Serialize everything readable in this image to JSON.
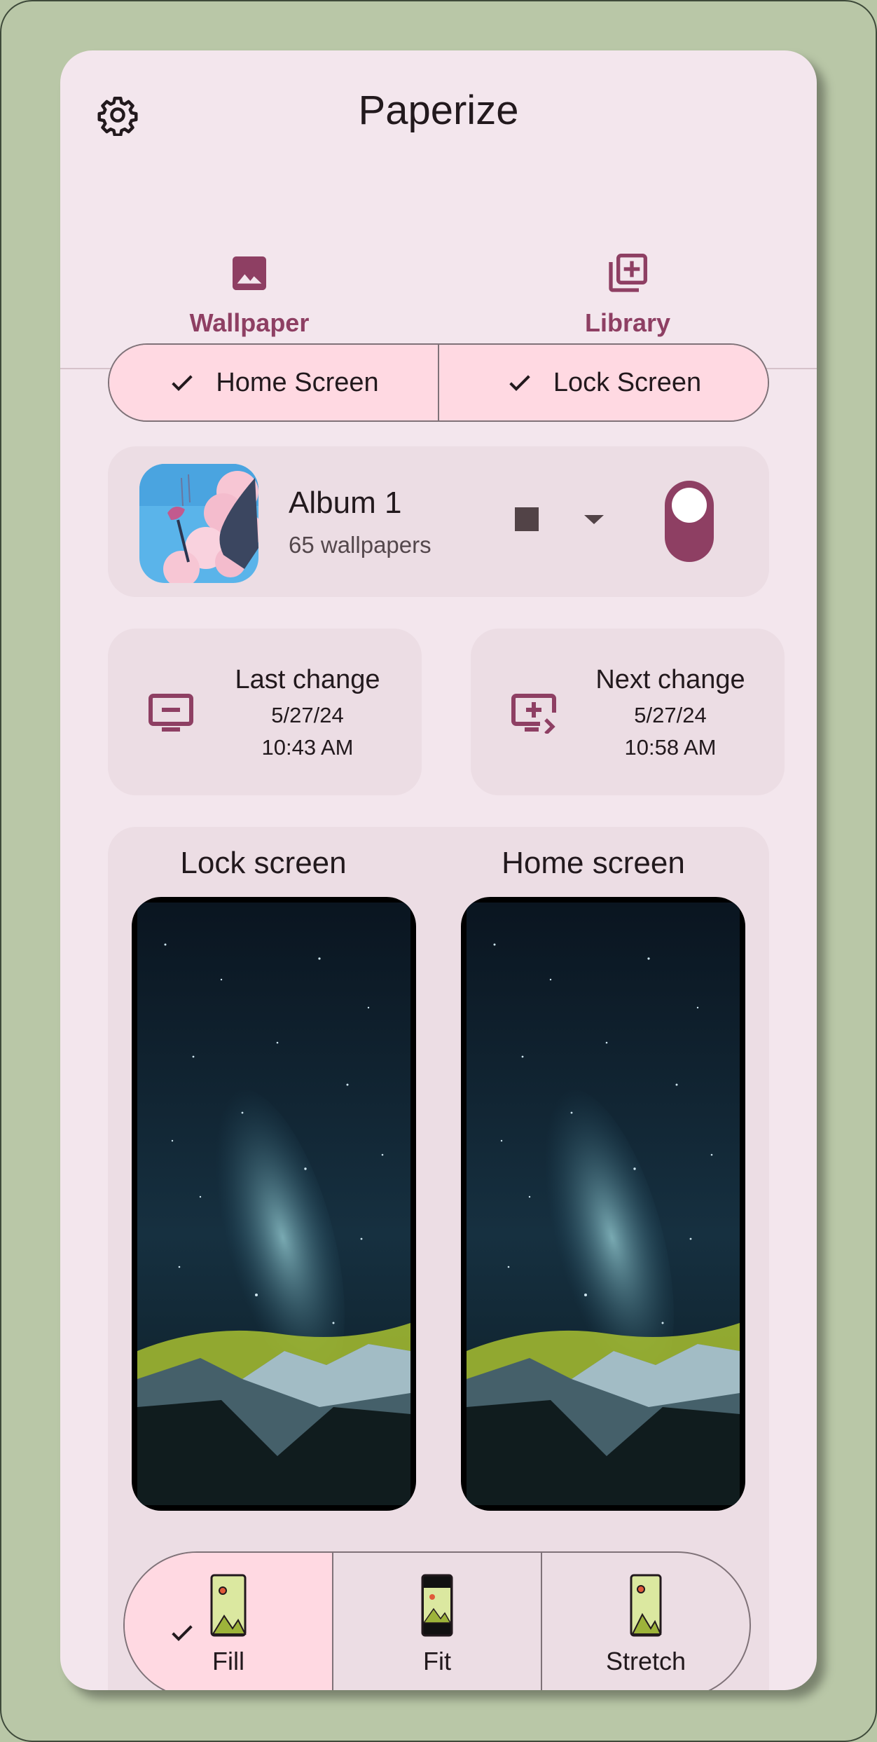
{
  "app": {
    "title": "Paperize"
  },
  "tabs": [
    {
      "label": "Wallpaper",
      "icon": "image-icon",
      "selected": true
    },
    {
      "label": "Library",
      "icon": "add-to-library-icon",
      "selected": false
    }
  ],
  "targets": [
    {
      "label": "Home Screen",
      "checked": true
    },
    {
      "label": "Lock Screen",
      "checked": true
    }
  ],
  "album": {
    "name": "Album 1",
    "count": "65 wallpapers",
    "enabled": true
  },
  "last_change": {
    "title": "Last change",
    "date": "5/27/24",
    "time": "10:43 AM"
  },
  "next_change": {
    "title": "Next change",
    "date": "5/27/24",
    "time": "10:58 AM"
  },
  "preview": {
    "lock_label": "Lock screen",
    "home_label": "Home screen"
  },
  "scaling": {
    "options": [
      {
        "label": "Fill",
        "selected": true
      },
      {
        "label": "Fit",
        "selected": false
      },
      {
        "label": "Stretch",
        "selected": false
      }
    ]
  },
  "colors": {
    "accent": "#8e3f63",
    "background": "#f3e6ed",
    "card": "#ecdde4",
    "selected_container": "#ffd9e2",
    "outer": "#b9c7a7"
  }
}
